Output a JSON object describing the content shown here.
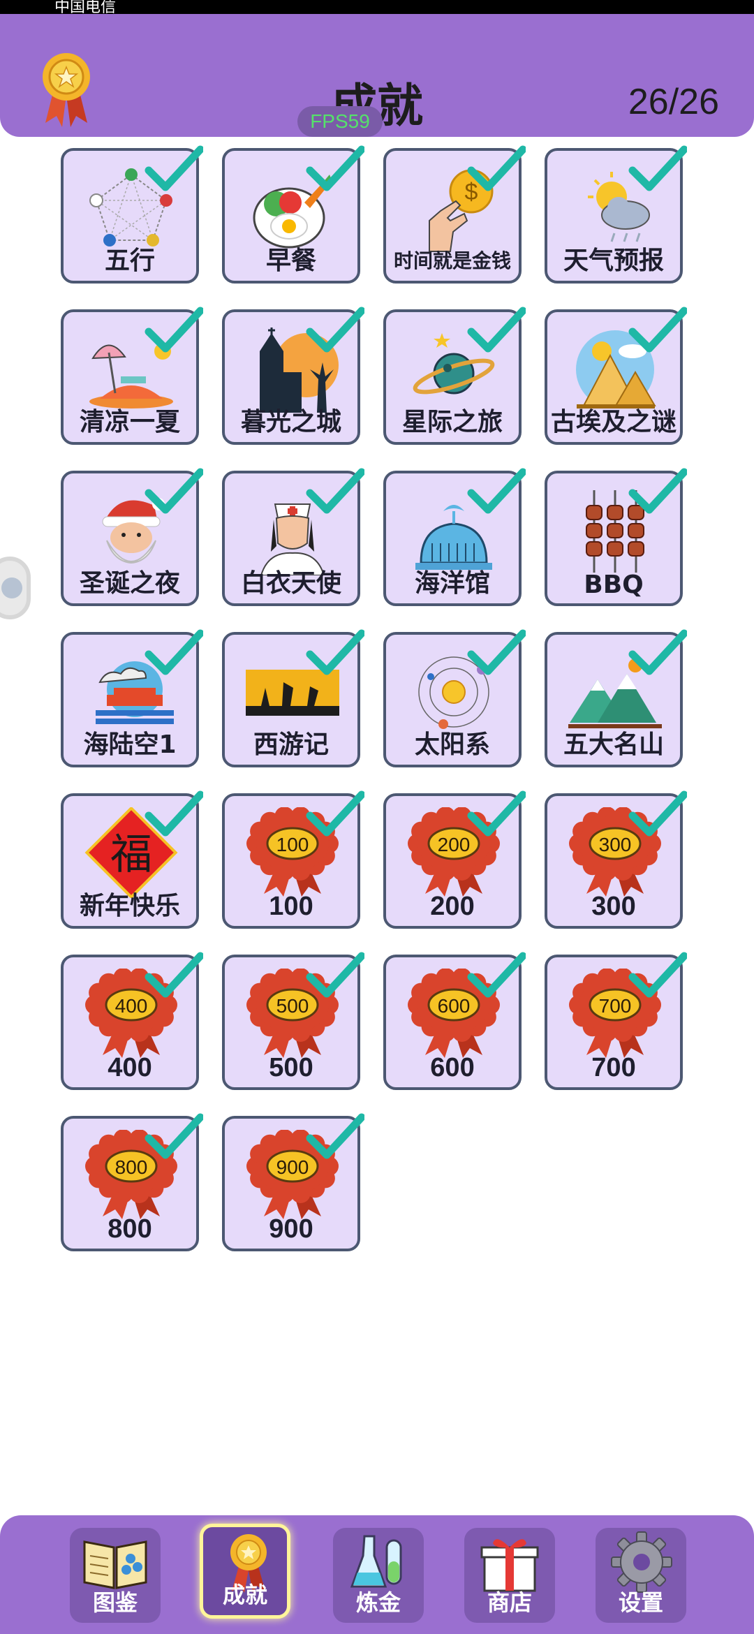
{
  "status_bar": {
    "carrier": "中国电信"
  },
  "header": {
    "title": "成就",
    "progress": "26/26",
    "fps": "FPS59"
  },
  "achievements": [
    {
      "label": "五行",
      "icon": "five-elements-icon",
      "completed": true
    },
    {
      "label": "早餐",
      "icon": "breakfast-icon",
      "completed": true
    },
    {
      "label": "时间就是金钱",
      "icon": "time-is-money-icon",
      "completed": true
    },
    {
      "label": "天气预报",
      "icon": "weather-icon",
      "completed": true
    },
    {
      "label": "清凉一夏",
      "icon": "summer-icon",
      "completed": true
    },
    {
      "label": "暮光之城",
      "icon": "twilight-city-icon",
      "completed": true
    },
    {
      "label": "星际之旅",
      "icon": "planet-icon",
      "completed": true
    },
    {
      "label": "古埃及之谜",
      "icon": "pyramid-icon",
      "completed": true
    },
    {
      "label": "圣诞之夜",
      "icon": "santa-icon",
      "completed": true
    },
    {
      "label": "白衣天使",
      "icon": "nurse-icon",
      "completed": true
    },
    {
      "label": "海洋馆",
      "icon": "whale-icon",
      "completed": true
    },
    {
      "label": "BBQ",
      "icon": "skewers-icon",
      "completed": true
    },
    {
      "label": "海陆空1",
      "icon": "sea-land-air-icon",
      "completed": true
    },
    {
      "label": "西游记",
      "icon": "journey-west-icon",
      "completed": true
    },
    {
      "label": "太阳系",
      "icon": "solar-system-icon",
      "completed": true
    },
    {
      "label": "五大名山",
      "icon": "mountains-icon",
      "completed": true
    },
    {
      "label": "新年快乐",
      "icon": "fu-icon",
      "completed": true
    },
    {
      "label": "100",
      "icon": "medal-icon",
      "badge": "100",
      "completed": true
    },
    {
      "label": "200",
      "icon": "medal-icon",
      "badge": "200",
      "completed": true
    },
    {
      "label": "300",
      "icon": "medal-icon",
      "badge": "300",
      "completed": true
    },
    {
      "label": "400",
      "icon": "medal-icon",
      "badge": "400",
      "completed": true
    },
    {
      "label": "500",
      "icon": "medal-icon",
      "badge": "500",
      "completed": true
    },
    {
      "label": "600",
      "icon": "medal-icon",
      "badge": "600",
      "completed": true
    },
    {
      "label": "700",
      "icon": "medal-icon",
      "badge": "700",
      "completed": true
    },
    {
      "label": "800",
      "icon": "medal-icon",
      "badge": "800",
      "completed": true
    },
    {
      "label": "900",
      "icon": "medal-icon",
      "badge": "900",
      "completed": true
    }
  ],
  "bottom_nav": {
    "items": [
      {
        "label": "图鉴",
        "icon": "book-icon",
        "active": false
      },
      {
        "label": "成就",
        "icon": "medal-icon",
        "active": true
      },
      {
        "label": "炼金",
        "icon": "flask-icon",
        "active": false
      },
      {
        "label": "商店",
        "icon": "gift-icon",
        "active": false
      },
      {
        "label": "设置",
        "icon": "gear-icon",
        "active": false
      }
    ]
  },
  "colors": {
    "header_bg": "#9a6fd0",
    "tile_bg": "#e6dafa",
    "tile_border": "#4c5872",
    "check": "#1fb8a6",
    "medal_red": "#d9442c",
    "medal_gold": "#f6c325"
  }
}
